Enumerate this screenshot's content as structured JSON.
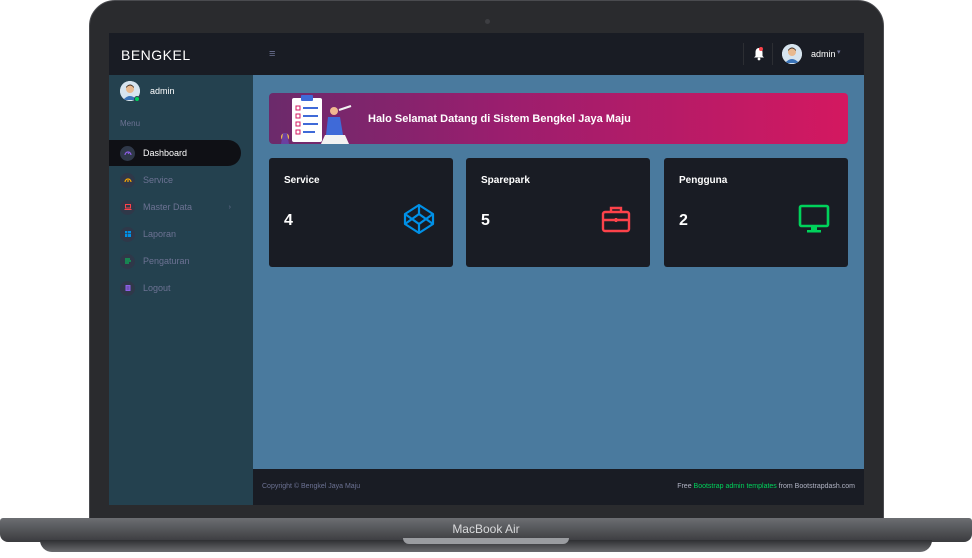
{
  "device": {
    "label": "MacBook Air"
  },
  "navbar": {
    "brand": "BENGKEL",
    "menu_toggle": "≡",
    "user": "admin",
    "caret": "▾"
  },
  "sidebar": {
    "user": "admin",
    "heading": "Menu",
    "items": [
      {
        "label": "Dashboard",
        "icon": "speedometer-icon",
        "icon_color": "#8f5fe8",
        "active": true
      },
      {
        "label": "Service",
        "icon": "gauge-icon",
        "icon_color": "#ffab00"
      },
      {
        "label": "Master Data",
        "icon": "laptop-icon",
        "icon_color": "#fc424a",
        "has_arrow": true
      },
      {
        "label": "Laporan",
        "icon": "table-icon",
        "icon_color": "#0090e7"
      },
      {
        "label": "Pengaturan",
        "icon": "chart-icon",
        "icon_color": "#00d25b"
      },
      {
        "label": "Logout",
        "icon": "document-icon",
        "icon_color": "#8f5fe8"
      }
    ]
  },
  "banner": {
    "text": "Halo Selamat Datang di Sistem Bengkel Jaya Maju"
  },
  "cards": [
    {
      "title": "Service",
      "value": "4",
      "icon": "codepen-icon",
      "icon_color": "#0090e7"
    },
    {
      "title": "Sparepark",
      "value": "5",
      "icon": "briefcase-icon",
      "icon_color": "#fc424a"
    },
    {
      "title": "Pengguna",
      "value": "2",
      "icon": "monitor-icon",
      "icon_color": "#00d25b"
    }
  ],
  "footer": {
    "copyright": "Copyright © Bengkel Jaya Maju",
    "free_prefix": "Free ",
    "link_text": "Bootstrap admin templates",
    "from_text": " from Bootstrapdash.com"
  },
  "colors": {
    "accent_green": "#00d25b",
    "accent_red": "#fc424a",
    "accent_blue": "#0090e7"
  }
}
